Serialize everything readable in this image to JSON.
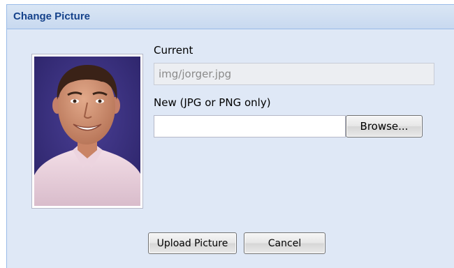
{
  "dialog": {
    "title": "Change Picture",
    "photo_alt": "Profile photo",
    "current_label": "Current",
    "current_value": "img/jorger.jpg",
    "new_label": "New (JPG or PNG only)",
    "new_value": "",
    "browse_label": "Browse...",
    "upload_label": "Upload Picture",
    "cancel_label": "Cancel"
  },
  "colors": {
    "title_text": "#15428b",
    "panel_background": "#dfe8f6",
    "border": "#99bbe8",
    "photo_background": "#3a2f7c"
  }
}
